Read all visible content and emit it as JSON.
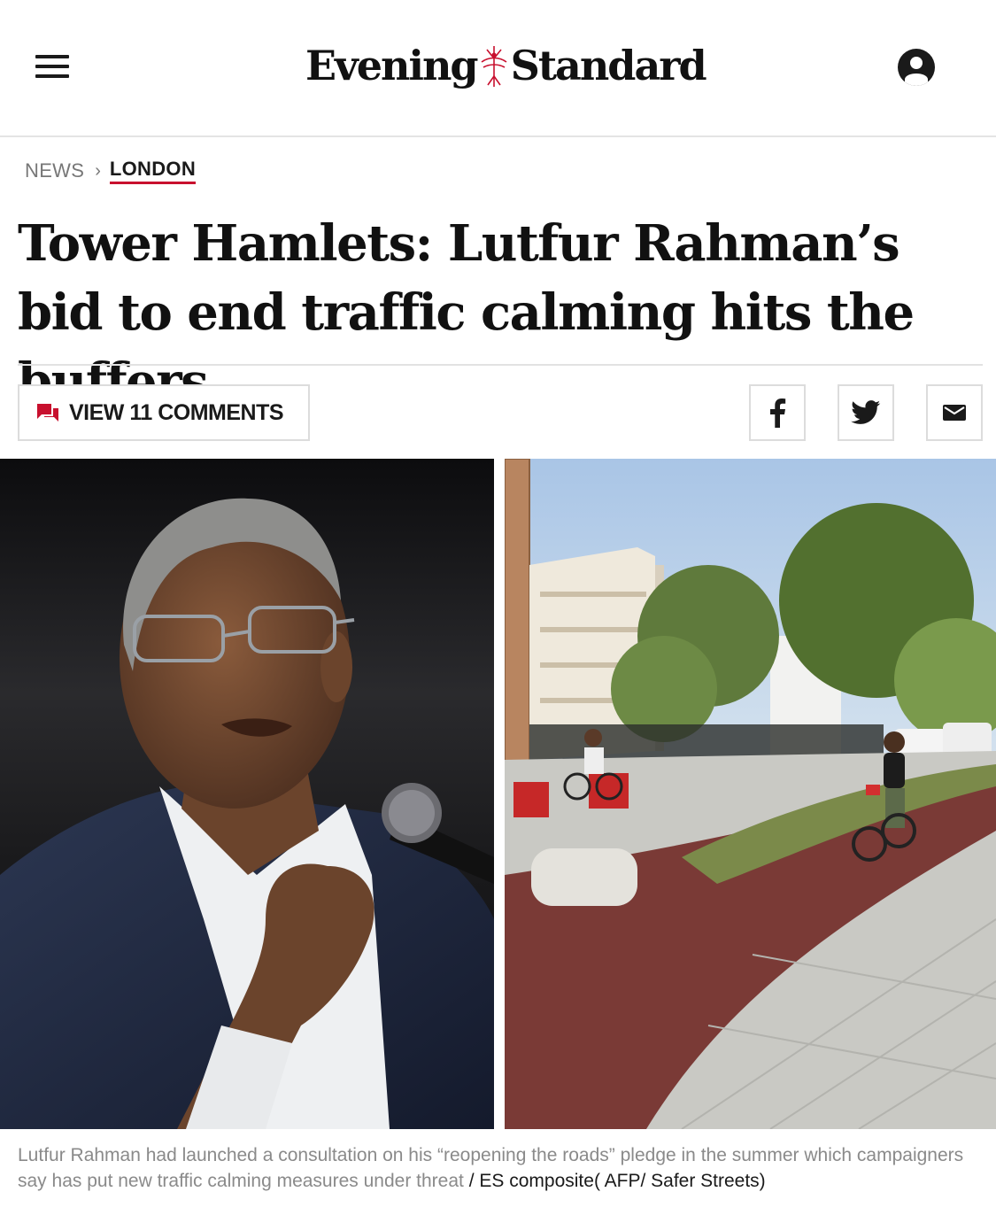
{
  "header": {
    "logo_text_left": "Evening",
    "logo_text_right": "Standard",
    "menu_icon": "hamburger-menu-icon",
    "account_icon": "user-account-icon"
  },
  "breadcrumb": {
    "section": "NEWS",
    "separator": "›",
    "subsection": "LONDON"
  },
  "article": {
    "headline": "Tower Hamlets: Lutfur Rahman’s bid to end traffic calming hits the buffers"
  },
  "actions": {
    "comments_label": "VIEW 11 COMMENTS",
    "comments_icon": "comment-bubbles-icon",
    "share_icons": [
      "facebook-icon",
      "twitter-icon",
      "email-icon"
    ]
  },
  "caption": {
    "text": "Lutfur Rahman had launched a consultation on his “reopening the roads” pledge in the summer which campaigners say has put new traffic calming measures under threat",
    "separator": " / ",
    "credit": "ES composite( AFP/ Safer Streets)"
  },
  "colors": {
    "accent_red": "#c8102e",
    "text_dark": "#1a1a1a",
    "text_muted": "#8a8a8a",
    "border": "#dcdcdc"
  }
}
